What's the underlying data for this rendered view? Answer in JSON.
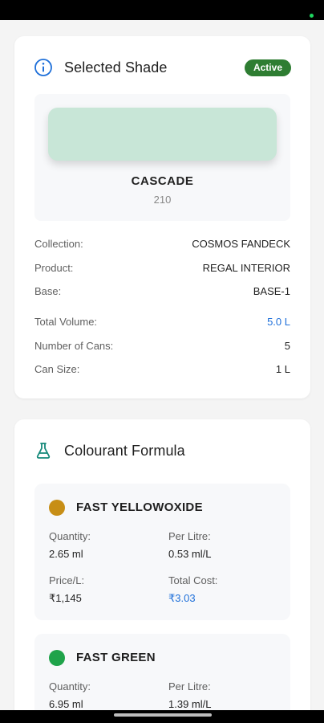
{
  "selected_shade": {
    "title": "Selected Shade",
    "icon": "info-icon",
    "status_badge": "Active",
    "accent_color": "#1e6fd9",
    "badge_color": "#2e7d32",
    "swatch_color": "#c8e6d7",
    "shade_name": "CASCADE",
    "shade_code": "210",
    "details": [
      {
        "label": "Collection:",
        "value": "COSMOS FANDECK"
      },
      {
        "label": "Product:",
        "value": "REGAL INTERIOR"
      },
      {
        "label": "Base:",
        "value": "BASE-1"
      },
      {
        "label": "Total Volume:",
        "value": "5.0 L"
      },
      {
        "label": "Number of Cans:",
        "value": "5"
      },
      {
        "label": "Can Size:",
        "value": "1 L"
      }
    ]
  },
  "colourant_formula": {
    "title": "Colourant Formula",
    "icon": "flask-icon",
    "items": [
      {
        "name": "FAST YELLOWOXIDE",
        "color": "#c78e16",
        "quantity_label": "Quantity:",
        "quantity": "2.65 ml",
        "per_litre_label": "Per Litre:",
        "per_litre": "0.53 ml/L",
        "price_label": "Price/L:",
        "price": "₹1,145",
        "total_label": "Total Cost:",
        "total": "₹3.03"
      },
      {
        "name": "FAST GREEN",
        "color": "#1fa34a",
        "quantity_label": "Quantity:",
        "quantity": "6.95 ml",
        "per_litre_label": "Per Litre:",
        "per_litre": "1.39 ml/L"
      }
    ]
  }
}
